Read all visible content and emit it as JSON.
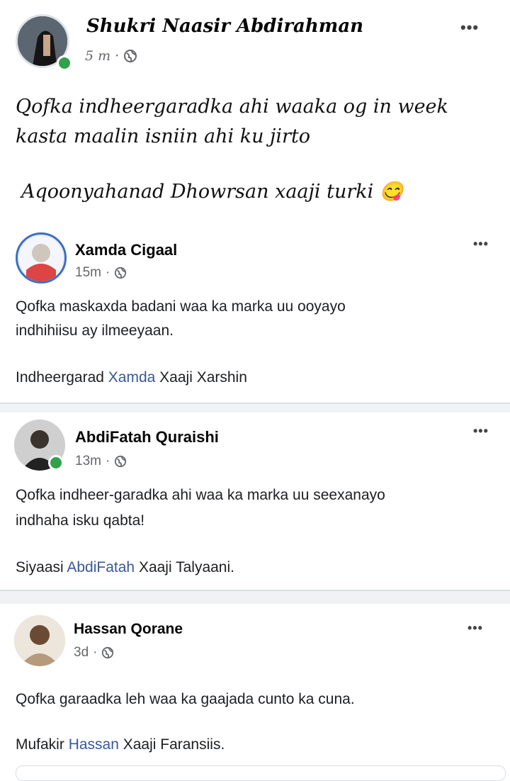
{
  "post1": {
    "author": "Shukri Naasir Abdirahman",
    "time": "5 m",
    "separator": "·",
    "text_line1": "Qofka indheergaradka ahi waaka og in week",
    "text_line2": "kasta maalin isniin ahi ku jirto",
    "text_line3": "Aqoonyahanad Dhowrsan xaaji turki",
    "emoji": "😋"
  },
  "post2": {
    "author": "Xamda Cigaal",
    "time": "15m",
    "separator": "·",
    "text_line1": "Qofka maskaxda badani waa ka marka uu ooyayo",
    "text_line2": "indhihiisu ay ilmeeyaan.",
    "sig_prefix": "Indheergarad ",
    "sig_link": "Xamda",
    "sig_suffix": " Xaaji Xarshin"
  },
  "post3": {
    "author": "AbdiFatah Quraishi",
    "time": "13m",
    "separator": "·",
    "text_line1": "Qofka indheer-garadka ahi waa ka marka uu seexanayo",
    "text_line2": "indhaha isku qabta!",
    "sig_prefix": "Siyaasi ",
    "sig_link": "AbdiFatah",
    "sig_suffix": " Xaaji Talyaani."
  },
  "post4": {
    "author": "Hassan Qorane",
    "time": "3d",
    "separator": "·",
    "text_line1": "Qofka garaadka leh waa ka gaajada cunto ka cuna.",
    "sig_prefix": "Mufakir ",
    "sig_link": "Hassan",
    "sig_suffix": " Xaaji Faransiis."
  },
  "menu_dots": "•••"
}
